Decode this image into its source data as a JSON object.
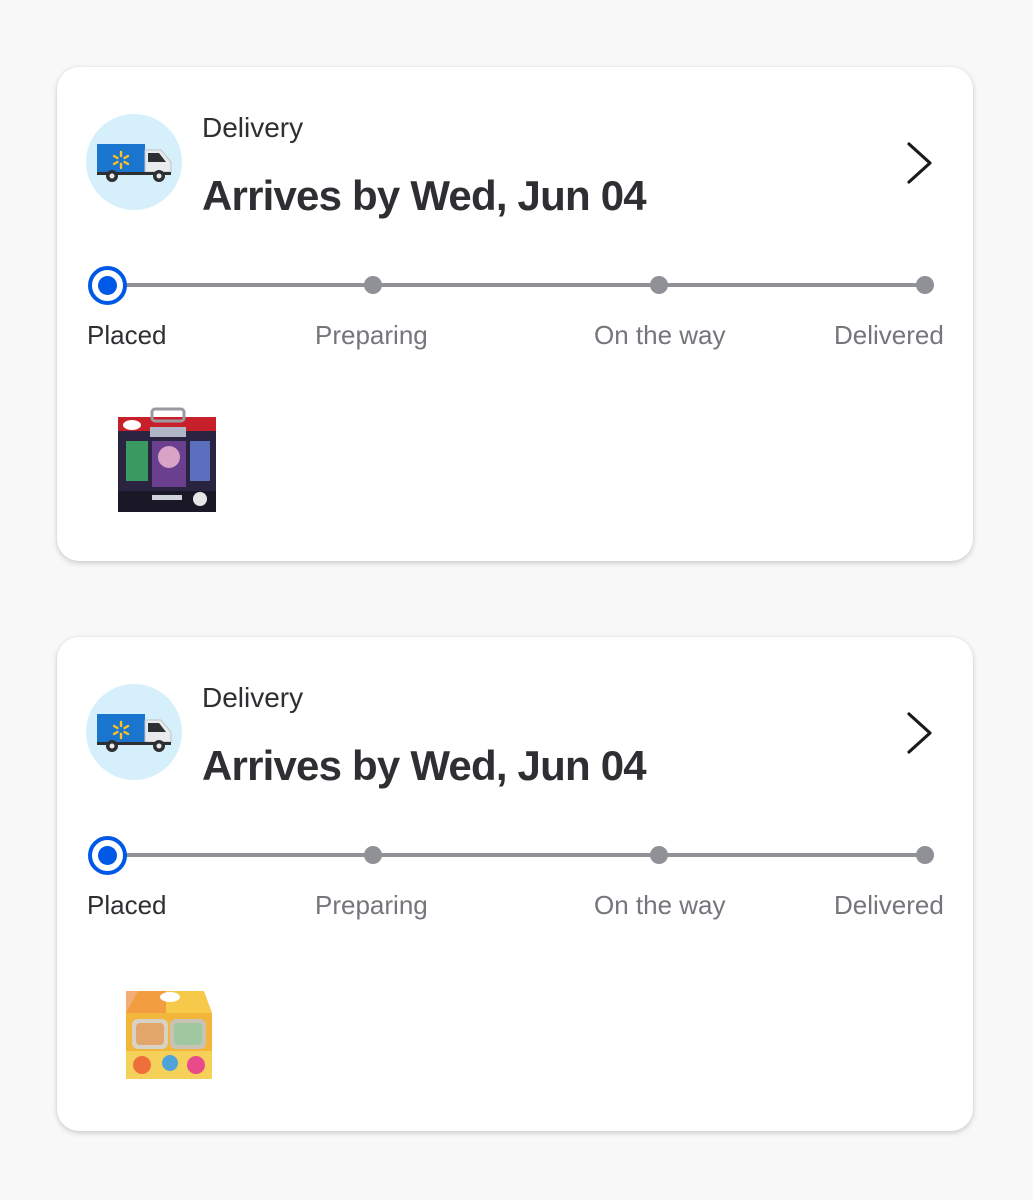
{
  "orders": [
    {
      "method": "Delivery",
      "eta": "Arrives by Wed, Jun 04",
      "icon": "delivery-truck-icon",
      "steps": [
        "Placed",
        "Preparing",
        "On the way",
        "Delivered"
      ],
      "current_step": "Placed",
      "product_image": "pokemon-battle-deck-box"
    },
    {
      "method": "Delivery",
      "eta": "Arrives by Wed, Jun 04",
      "icon": "delivery-truck-icon",
      "steps": [
        "Placed",
        "Preparing",
        "On the way",
        "Delivered"
      ],
      "current_step": "Placed",
      "product_image": "pokemon-mini-tin-display-box"
    }
  ],
  "colors": {
    "accent": "#0058e6",
    "step_inactive": "#909196",
    "icon_bg": "#d6f0fb",
    "truck_blue": "#1a75cf",
    "spark_yellow": "#ffc220"
  }
}
